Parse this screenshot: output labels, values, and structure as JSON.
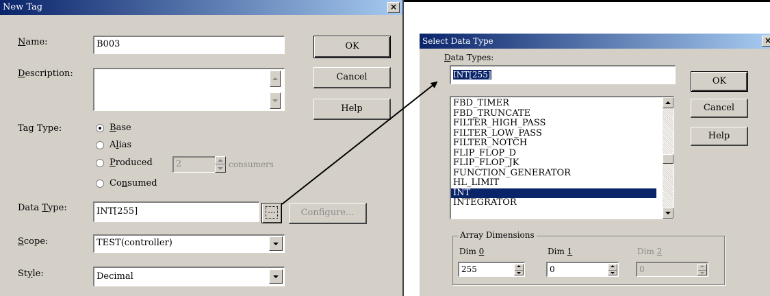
{
  "new_tag": {
    "title": "New Tag",
    "close": "×",
    "name_label": [
      "N",
      "ame:"
    ],
    "name_value": "B003",
    "description_label": [
      "D",
      "escription:"
    ],
    "ok": "OK",
    "cancel": "Cancel",
    "help": "Help",
    "tag_type_label": "Tag Type:",
    "tag_types": [
      {
        "u": "B",
        "rest": "ase",
        "checked": true
      },
      {
        "pre": "A",
        "u": "l",
        "rest": "ias",
        "checked": false
      },
      {
        "u": "P",
        "rest": "roduced",
        "checked": false
      },
      {
        "pre": "Co",
        "u": "n",
        "rest": "sumed",
        "checked": false
      }
    ],
    "consumers_value": "2",
    "consumers_label": "consumers",
    "data_type_label": [
      "Data ",
      "T",
      "ype:"
    ],
    "data_type_value": "INT[255]",
    "browse": "...",
    "configure": "Configure...",
    "scope_label": [
      "S",
      "cope:"
    ],
    "scope_value": "TEST(controller)",
    "style_label": [
      "St",
      "y",
      "le:"
    ],
    "style_value": "Decimal"
  },
  "select_data_type": {
    "title": "Select Data Type",
    "close": "×",
    "data_types_label": [
      "D",
      "ata Types:"
    ],
    "data_types_value": "INT[255]",
    "ok": "OK",
    "cancel": "Cancel",
    "help": "Help",
    "types": [
      "FBD_TIMER",
      "FBD_TRUNCATE",
      "FILTER_HIGH_PASS",
      "FILTER_LOW_PASS",
      "FILTER_NOTCH",
      "FLIP_FLOP_D",
      "FLIP_FLOP_JK",
      "FUNCTION_GENERATOR",
      "HL_LIMIT",
      "INT",
      "INTEGRATOR"
    ],
    "selected_type": "INT",
    "array_dimensions_label": "Array Dimensions",
    "dims": [
      {
        "label_pre": "Dim ",
        "label_u": "0",
        "value": "255",
        "enabled": true
      },
      {
        "label_pre": "Dim ",
        "label_u": "1",
        "value": "0",
        "enabled": true
      },
      {
        "label_pre": "Dim ",
        "label_u": "2",
        "value": "0",
        "enabled": false
      }
    ]
  }
}
